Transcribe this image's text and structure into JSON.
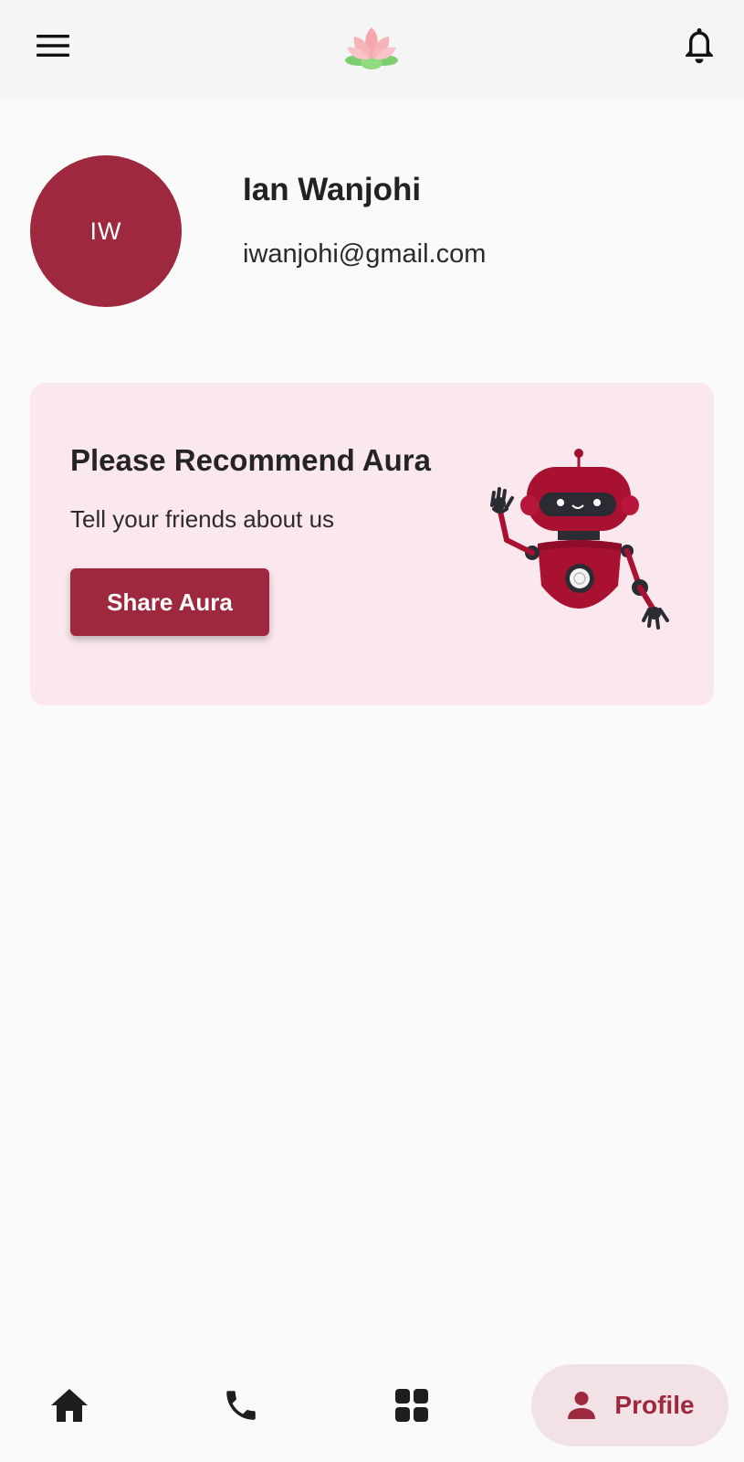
{
  "topbar": {
    "menu_icon": "hamburger-menu-icon",
    "logo_icon": "lotus-logo-icon",
    "bell_icon": "notification-bell-icon"
  },
  "profile": {
    "initials": "IW",
    "name": "Ian Wanjohi",
    "email": "iwanjohi@gmail.com"
  },
  "recommend_card": {
    "title": "Please Recommend Aura",
    "subtitle": "Tell your friends about us",
    "button_label": "Share Aura",
    "illustration": "waving-robot-icon"
  },
  "bottom_nav": {
    "items": [
      {
        "icon": "home-icon"
      },
      {
        "icon": "phone-icon"
      },
      {
        "icon": "grid-apps-icon"
      },
      {
        "icon": "person-icon",
        "label": "Profile",
        "active": true
      }
    ]
  },
  "colors": {
    "primary": "#9e283e",
    "card_background": "#fbe8ee",
    "active_nav_background": "#f2e2e6",
    "page_background": "#fafafa"
  }
}
